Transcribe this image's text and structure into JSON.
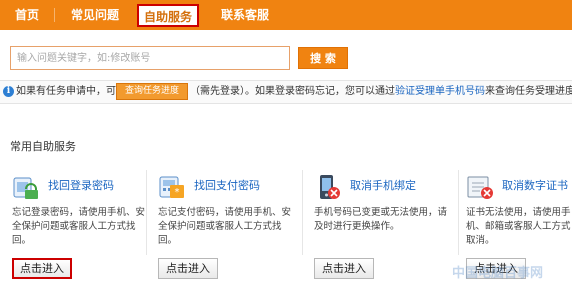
{
  "nav": {
    "tabs": [
      {
        "label": "首页"
      },
      {
        "label": "常见问题"
      },
      {
        "label": "自助服务"
      },
      {
        "label": "联系客服"
      }
    ]
  },
  "search": {
    "placeholder": "输入问题关键字，如:修改账号",
    "button_label": "搜 索"
  },
  "notice": {
    "prefix": "如果有任务申请中，可",
    "progress_button": "查询任务进度",
    "suffix_1": "（需先登录）。如果登录密码忘记，您可以通过",
    "link": "验证受理单手机号码",
    "suffix_2": "来查询任务受理进度。"
  },
  "section": {
    "title": "常用自助服务"
  },
  "cards": [
    {
      "title": "找回登录密码",
      "desc": "忘记登录密码，请使用手机、安全保护问题或客服人工方式找回。",
      "button": "点击进入",
      "icon": "lock-icon"
    },
    {
      "title": "找回支付密码",
      "desc": "忘记支付密码，请使用手机、安全保护问题或客服人工方式找回。",
      "button": "点击进入",
      "icon": "keypad-icon"
    },
    {
      "title": "取消手机绑定",
      "desc": "手机号码已变更或无法使用，请及时进行更换操作。",
      "button": "点击进入",
      "icon": "phone-icon"
    },
    {
      "title": "取消数字证书",
      "desc": "证书无法使用，请使用手机、邮箱或客服人工方式取消。",
      "button": "点击进入",
      "icon": "certificate-icon"
    }
  ],
  "watermark": "中国电脑百事网",
  "colors": {
    "accent": "#f08311",
    "link": "#1a65c0",
    "highlight": "#cc0000"
  }
}
